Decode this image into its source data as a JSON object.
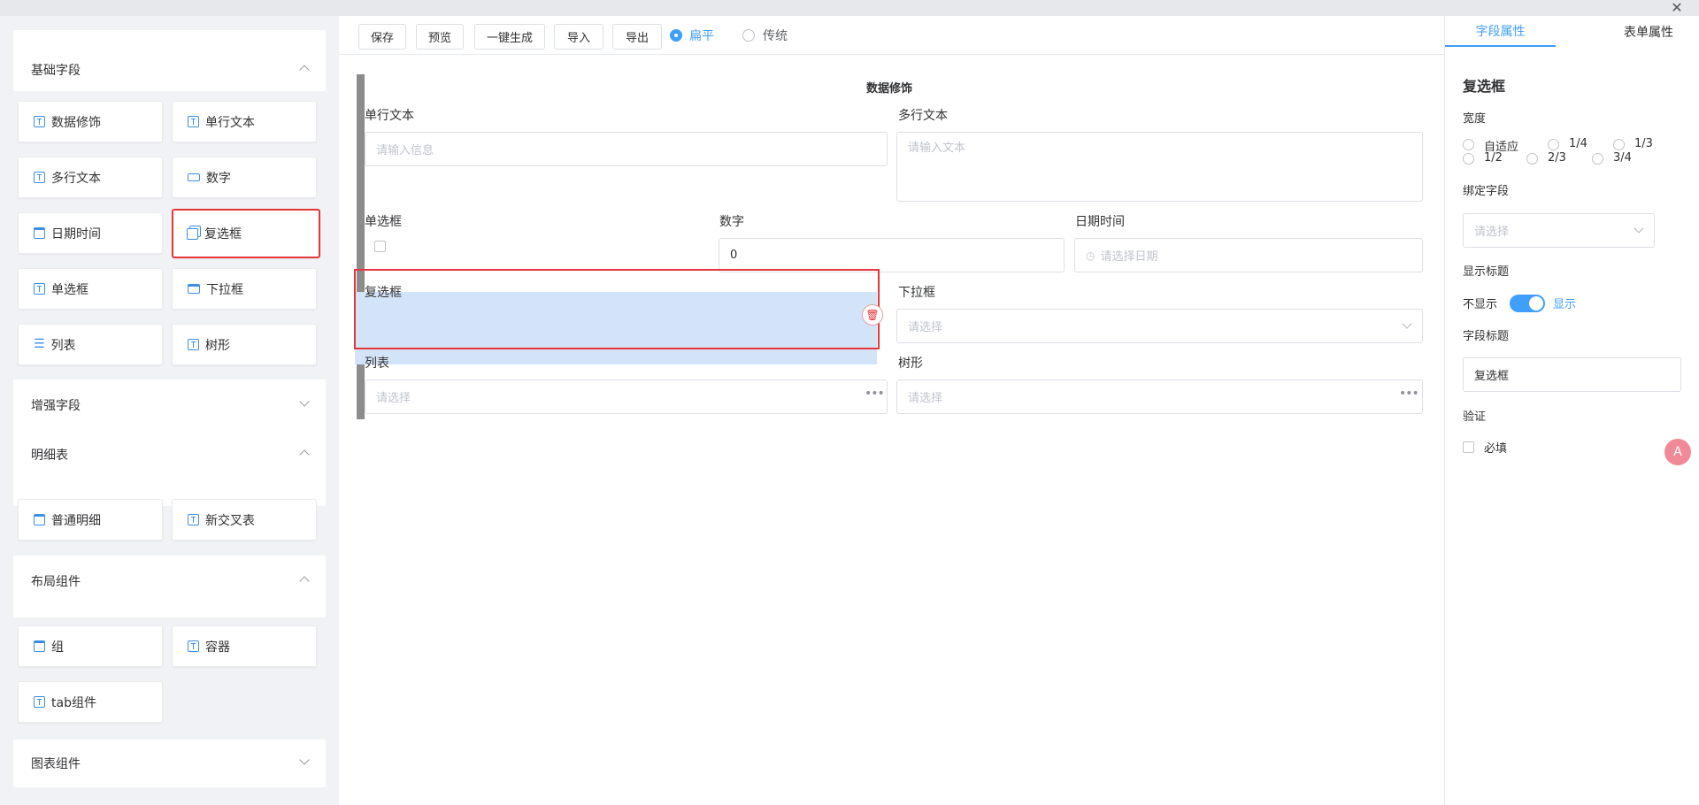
{
  "window": {
    "close_glyph": "✕"
  },
  "palette": {
    "sections": [
      {
        "title": "基础字段",
        "state": "expanded"
      },
      {
        "title": "增强字段",
        "state": "collapsed"
      },
      {
        "title": "明细表",
        "state": "expanded"
      },
      {
        "title": "布局组件",
        "state": "expanded"
      },
      {
        "title": "图表组件",
        "state": "collapsed"
      }
    ],
    "basic_items": [
      {
        "label": "数据修饰",
        "icon": "text-field-icon"
      },
      {
        "label": "单行文本",
        "icon": "text-field-icon"
      },
      {
        "label": "多行文本",
        "icon": "text-field-icon"
      },
      {
        "label": "数字",
        "icon": "number-icon"
      },
      {
        "label": "日期时间",
        "icon": "calendar-icon"
      },
      {
        "label": "复选框",
        "icon": "checkbox-icon"
      },
      {
        "label": "单选框",
        "icon": "text-field-icon"
      },
      {
        "label": "下拉框",
        "icon": "dropdown-icon"
      },
      {
        "label": "列表",
        "icon": "list-icon"
      },
      {
        "label": "树形",
        "icon": "text-field-icon"
      }
    ],
    "detail_items": [
      {
        "label": "普通明细",
        "icon": "table-icon"
      },
      {
        "label": "新交叉表",
        "icon": "text-field-icon"
      }
    ],
    "layout_items": [
      {
        "label": "组",
        "icon": "layout-icon"
      },
      {
        "label": "容器",
        "icon": "text-field-icon"
      },
      {
        "label": "tab组件",
        "icon": "text-field-icon"
      }
    ]
  },
  "toolbar": {
    "buttons": [
      "保存",
      "预览",
      "一键生成",
      "导入",
      "导出"
    ],
    "style_options": [
      {
        "label": "扁平",
        "selected": true
      },
      {
        "label": "传统",
        "selected": false
      }
    ]
  },
  "canvas": {
    "title": "数据修饰",
    "single_text": {
      "label": "单行文本",
      "placeholder": "请输入信息"
    },
    "multi_text": {
      "label": "多行文本",
      "placeholder": "请输入文本"
    },
    "radio": {
      "label": "单选框"
    },
    "number": {
      "label": "数字",
      "value": "0"
    },
    "datetime": {
      "label": "日期时间",
      "placeholder": "请选择日期"
    },
    "checkbox": {
      "label": "复选框"
    },
    "dropdown": {
      "label": "下拉框",
      "placeholder": "请选择"
    },
    "list": {
      "label": "列表",
      "placeholder": "请选择"
    },
    "tree": {
      "label": "树形",
      "placeholder": "请选择"
    }
  },
  "props": {
    "tabs": [
      {
        "label": "字段属性",
        "active": true
      },
      {
        "label": "表单属性",
        "active": false
      }
    ],
    "field_name": "复选框",
    "width_label": "宽度",
    "width_options": [
      "自适应",
      "1/4",
      "1/3",
      "1/2",
      "2/3",
      "3/4"
    ],
    "bind_label": "绑定字段",
    "bind_placeholder": "请选择",
    "show_title_label": "显示标题",
    "toggle_off": "不显示",
    "toggle_on": "显示",
    "toggle_value": true,
    "field_title_label": "字段标题",
    "field_title_value": "复选框",
    "validation_label": "验证",
    "required_label": "必填"
  },
  "colors": {
    "accent": "#409eff",
    "highlight": "#e5373b",
    "selection": "#d3e4f8"
  }
}
